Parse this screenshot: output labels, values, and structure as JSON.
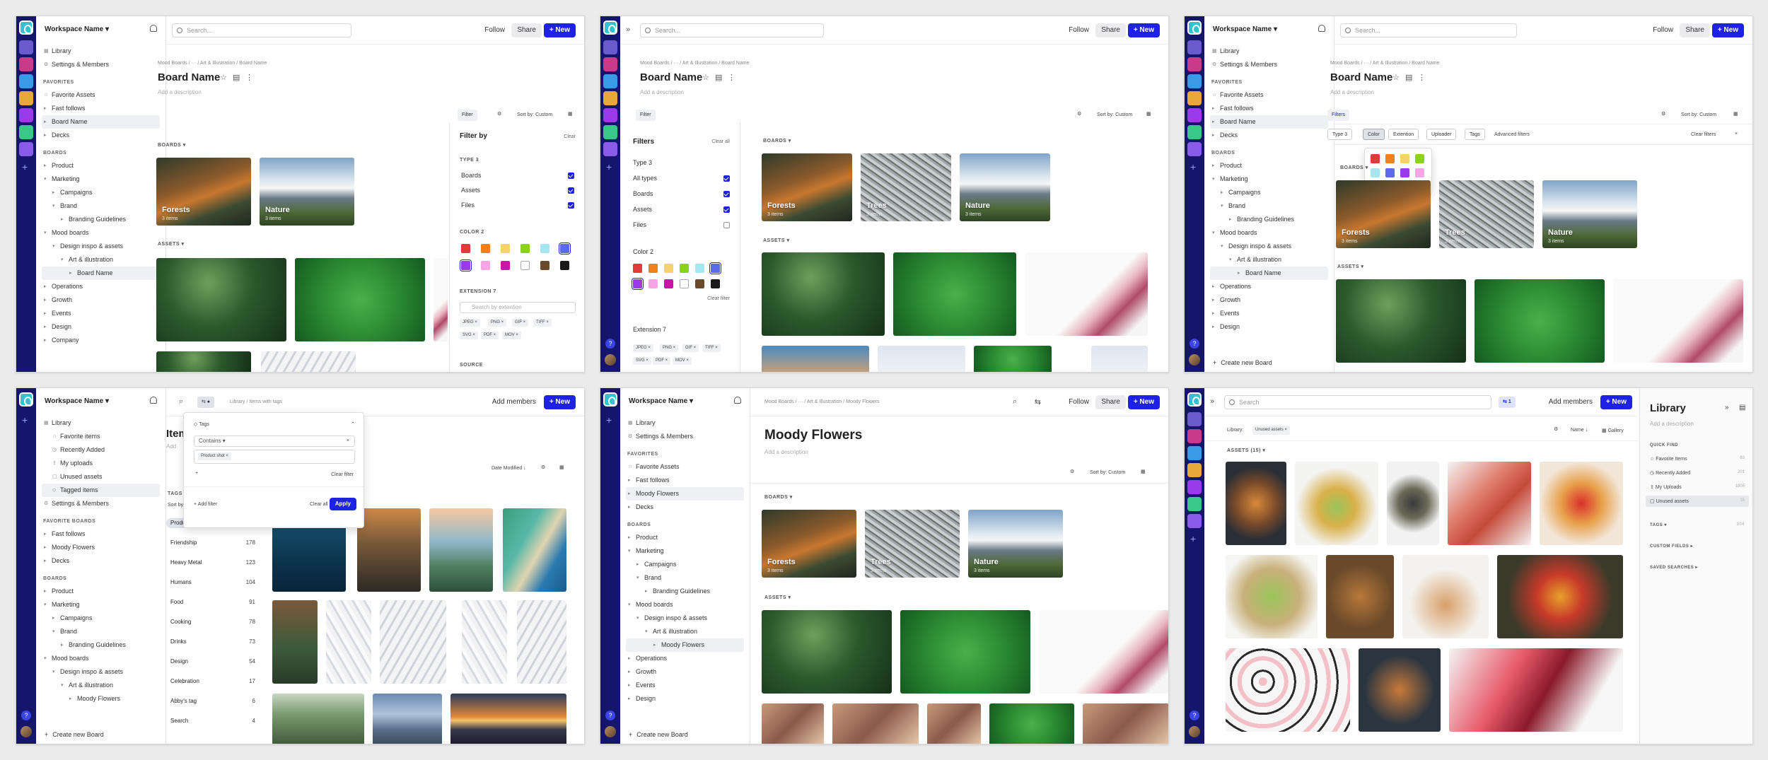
{
  "common": {
    "workspace_name": "Workspace Name",
    "search_placeholder": "Search...",
    "follow": "Follow",
    "share": "Share",
    "new": "+ New",
    "library": "Library",
    "settings_members": "Settings & Members",
    "favorites": "FAVORITES",
    "favorite_assets": "Favorite Assets",
    "fast_follows": "Fast follows",
    "board_name_nav": "Board Name",
    "decks": "Decks",
    "boards_hdr": "BOARDS",
    "product": "Product",
    "marketing": "Marketing",
    "campaigns": "Campaigns",
    "brand": "Brand",
    "branding_guidelines": "Branding Guidelines",
    "mood_boards": "Mood boards",
    "design_inspo": "Design inspo & assets",
    "art_illustration": "Art & illustration",
    "operations": "Operations",
    "growth": "Growth",
    "events": "Events",
    "design": "Design",
    "company": "Company",
    "create_new_board": "Create new Board",
    "breadcrumb": "Mood Boards  /  ···  /  Art & Illustration  /  Board Name",
    "board_title": "Board Name",
    "add_description": "Add a description",
    "filter": "Filter",
    "filters": "Filters",
    "sort_custom": "Sort by: Custom",
    "boards_section": "BOARDS",
    "assets_section": "ASSETS",
    "forests": "Forests",
    "trees": "Trees",
    "nature": "Nature",
    "three_items": "3 items",
    "x_items": "3 items"
  },
  "p1": {
    "filter_by": "Filter by",
    "clear": "Clear",
    "type_label": "TYPE",
    "type_count": "3",
    "types": [
      "Boards",
      "Assets",
      "Files"
    ],
    "color_label": "COLOR",
    "color_count": "2",
    "extension_label": "EXTENSION",
    "ext_placeholder": "Search by extention",
    "extensions": [
      "JPEG",
      "PNG",
      "GIF",
      "TIFF",
      "SVG",
      "PDF",
      "MOV"
    ],
    "source_label": "SOURCE"
  },
  "p2": {
    "filters_title": "Filters",
    "clear_all": "Clear all",
    "type_label": "Type",
    "type_count": "3",
    "types": [
      "All types",
      "Boards",
      "Assets",
      "Files"
    ],
    "color_label": "Color",
    "color_count": "2",
    "clear_filter": "Clear filter",
    "extension_label": "Extension",
    "ext_count": "7",
    "extensions": [
      "JPEG",
      "PNG",
      "GIF",
      "TIFF",
      "SVG",
      "PDF",
      "MOV"
    ]
  },
  "p3": {
    "chips": [
      "Type",
      "Color",
      "Extention",
      "Uploader",
      "Tags"
    ],
    "type_count": "3",
    "advanced": "Advanced filters",
    "clear_filters": "Clear filters"
  },
  "p4": {
    "add_members": "Add members",
    "library_items": [
      "Favorite items",
      "Recently Added",
      "My uploads",
      "Unused assets",
      "Tagged items"
    ],
    "favorite_boards": "FAVORITE BOARDS",
    "moody_flowers": "Moody Flowers",
    "crumb": "Library  /  Items with tags",
    "items_title": "Item",
    "tags_popup_label": "Tags",
    "contains": "Contains",
    "product_shot_chip": "Product shot",
    "clear_filter": "Clear filter",
    "add_filter": "Add filter",
    "clear_all": "Clear all",
    "apply": "Apply",
    "date_modified": "Date Modified",
    "tags_hdr": "TAGS",
    "sort_by": "Sort by",
    "tags": [
      {
        "name": "Product shot",
        "count": "217"
      },
      {
        "name": "Friendship",
        "count": "178"
      },
      {
        "name": "Heavy Metal",
        "count": "123"
      },
      {
        "name": "Humans",
        "count": "104"
      },
      {
        "name": "Food",
        "count": "91"
      },
      {
        "name": "Cooking",
        "count": "78"
      },
      {
        "name": "Drinks",
        "count": "73"
      },
      {
        "name": "Design",
        "count": "54"
      },
      {
        "name": "Celebration",
        "count": "17"
      },
      {
        "name": "Abby's tag",
        "count": "6"
      },
      {
        "name": "Search",
        "count": "4"
      }
    ]
  },
  "p5": {
    "moody_flowers": "Moody Flowers",
    "breadcrumb": "Mood Boards  /  ···  /  Art & Illustration  /  Moody Flowers",
    "title": "Moody Flowers"
  },
  "p6": {
    "search_placeholder": "Search",
    "filter_count": "1",
    "add_members": "Add members",
    "library_label": "Library:",
    "unused_chip": "Unused assets",
    "name_sort": "Name",
    "gallery": "Gallery",
    "assets_count": "ASSETS (15)",
    "lib_title": "Library",
    "add_description": "Add a description",
    "quick_find": "QUICK FIND",
    "quick_items": [
      {
        "name": "Favorite Items",
        "count": "63"
      },
      {
        "name": "Recently Added",
        "count": "201"
      },
      {
        "name": "My Uploads",
        "count": "1805"
      },
      {
        "name": "Unused assets",
        "count": "15"
      }
    ],
    "tags": "TAGS",
    "tags_count": "304",
    "custom_fields": "CUSTOM FIELDS",
    "saved_searches": "SAVED SEARCHES"
  }
}
